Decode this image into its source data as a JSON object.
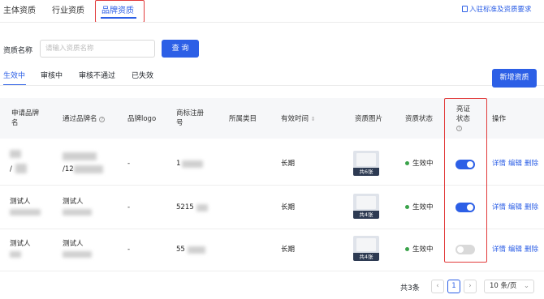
{
  "tabs": [
    "主体资质",
    "行业资质",
    "品牌资质"
  ],
  "header_link": "入驻标准及资质要求",
  "search": {
    "label": "资质名称",
    "placeholder": "请输入资质名称",
    "button": "查 询"
  },
  "status_tabs": [
    "生效中",
    "审核中",
    "审核不通过",
    "已失效"
  ],
  "add_button": "新增资质",
  "columns": {
    "brand": [
      "申请品牌",
      "名"
    ],
    "pass_brand": "通过品牌名",
    "logo": "品牌logo",
    "trademark": [
      "商标注册",
      "号"
    ],
    "category": "所属类目",
    "valid": "有效时间",
    "images": "资质图片",
    "status": "资质状态",
    "highlight": [
      "亮证",
      "状态"
    ],
    "ops": "操作"
  },
  "rows": [
    {
      "brand": "/",
      "pass_brand": "/12",
      "logo": "-",
      "trademark": "1",
      "valid": "长期",
      "images": "共6张",
      "status": "生效中",
      "highlight_on": true
    },
    {
      "brand": "测试人",
      "pass_brand": "测试人",
      "logo": "-",
      "trademark": "5215",
      "valid": "长期",
      "images": "共4张",
      "status": "生效中",
      "highlight_on": true
    },
    {
      "brand": "测试人",
      "pass_brand": "测试人",
      "logo": "-",
      "trademark": "55",
      "valid": "长期",
      "images": "共4张",
      "status": "生效中",
      "highlight_on": false
    }
  ],
  "ops": [
    "详情",
    "编辑",
    "删除"
  ],
  "pagination": {
    "total": "共3条",
    "page": "1",
    "per_page": "10 条/页"
  },
  "colors": {
    "accent": "#2c5fe6",
    "highlight_box": "#e23b3b",
    "status_ok": "#3aa34a"
  }
}
